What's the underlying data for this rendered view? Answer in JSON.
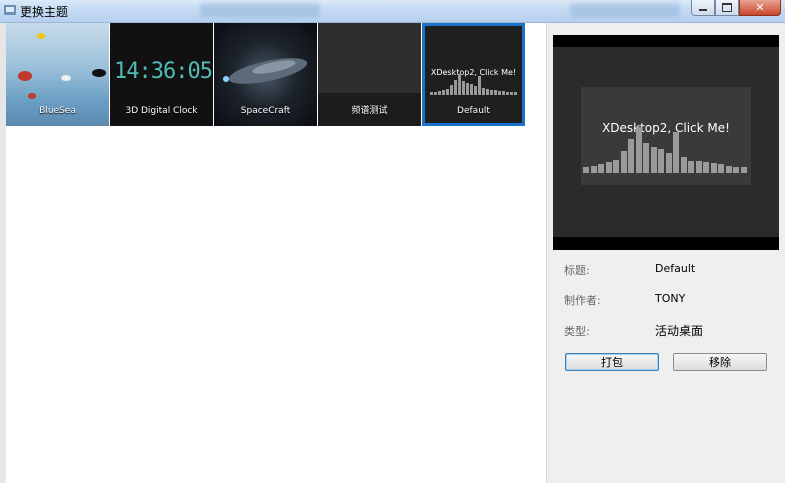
{
  "window": {
    "title": "更换主题",
    "icons": {
      "app": "app-icon",
      "minimize": "minimize-icon",
      "maximize": "maximize-icon",
      "close": "close-icon"
    }
  },
  "themes": [
    {
      "label": "BlueSea",
      "selected": false
    },
    {
      "label": "3D Digital Clock",
      "clock_text": "14:36:05",
      "selected": false
    },
    {
      "label": "SpaceCraft",
      "selected": false
    },
    {
      "label": "频谱测试",
      "selected": false
    },
    {
      "label": "Default",
      "overlay_text": "XDesktop2, Click Me!",
      "selected": true
    }
  ],
  "preview": {
    "overlay_text": "XDesktop2, Click Me!",
    "spectrum": [
      0.12,
      0.15,
      0.18,
      0.22,
      0.28,
      0.45,
      0.7,
      0.95,
      0.62,
      0.55,
      0.5,
      0.42,
      0.85,
      0.33,
      0.25,
      0.24,
      0.22,
      0.2,
      0.18,
      0.15,
      0.13,
      0.12
    ]
  },
  "details": {
    "title_label": "标题:",
    "title_value": "Default",
    "author_label": "制作者:",
    "author_value": "TONY",
    "type_label": "类型:",
    "type_value": "活动桌面"
  },
  "buttons": {
    "pack": "打包",
    "remove": "移除"
  },
  "colors": {
    "selection": "#1a73c8",
    "clock_digits": "#4fbdb6",
    "panel_bg": "#efefef"
  }
}
